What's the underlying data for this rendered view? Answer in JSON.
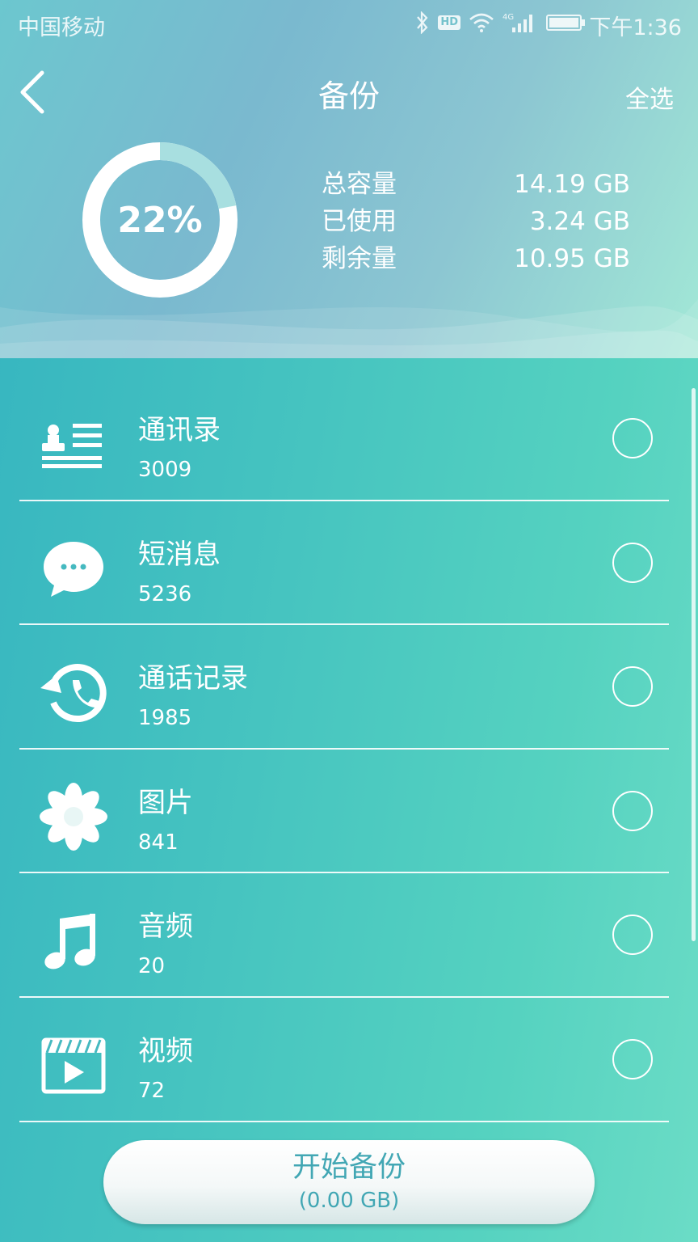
{
  "status_bar": {
    "carrier": "中国移动",
    "hd": "HD",
    "network": "4G",
    "time": "下午1:36"
  },
  "header": {
    "title": "备份",
    "select_all": "全选",
    "usage_percent_label": "22%",
    "usage_fraction": 0.22
  },
  "storage": [
    {
      "label": "总容量",
      "value": "14.19 GB"
    },
    {
      "label": "已使用",
      "value": "3.24 GB"
    },
    {
      "label": "剩余量",
      "value": "10.95 GB"
    }
  ],
  "items": [
    {
      "title": "通讯录",
      "count": "3009",
      "icon": "contacts-icon",
      "selected": false
    },
    {
      "title": "短消息",
      "count": "5236",
      "icon": "message-icon",
      "selected": false
    },
    {
      "title": "通话记录",
      "count": "1985",
      "icon": "call-history-icon",
      "selected": false
    },
    {
      "title": "图片",
      "count": "841",
      "icon": "flower-icon",
      "selected": false
    },
    {
      "title": "音频",
      "count": "20",
      "icon": "music-note-icon",
      "selected": false
    },
    {
      "title": "视频",
      "count": "72",
      "icon": "video-clapper-icon",
      "selected": false
    }
  ],
  "start_button": {
    "label": "开始备份",
    "size": "(0.00 GB)"
  },
  "colors": {
    "accent_text": "#42a7b4",
    "ring_track": "#ffffff",
    "ring_used": "#a8dfe0"
  }
}
